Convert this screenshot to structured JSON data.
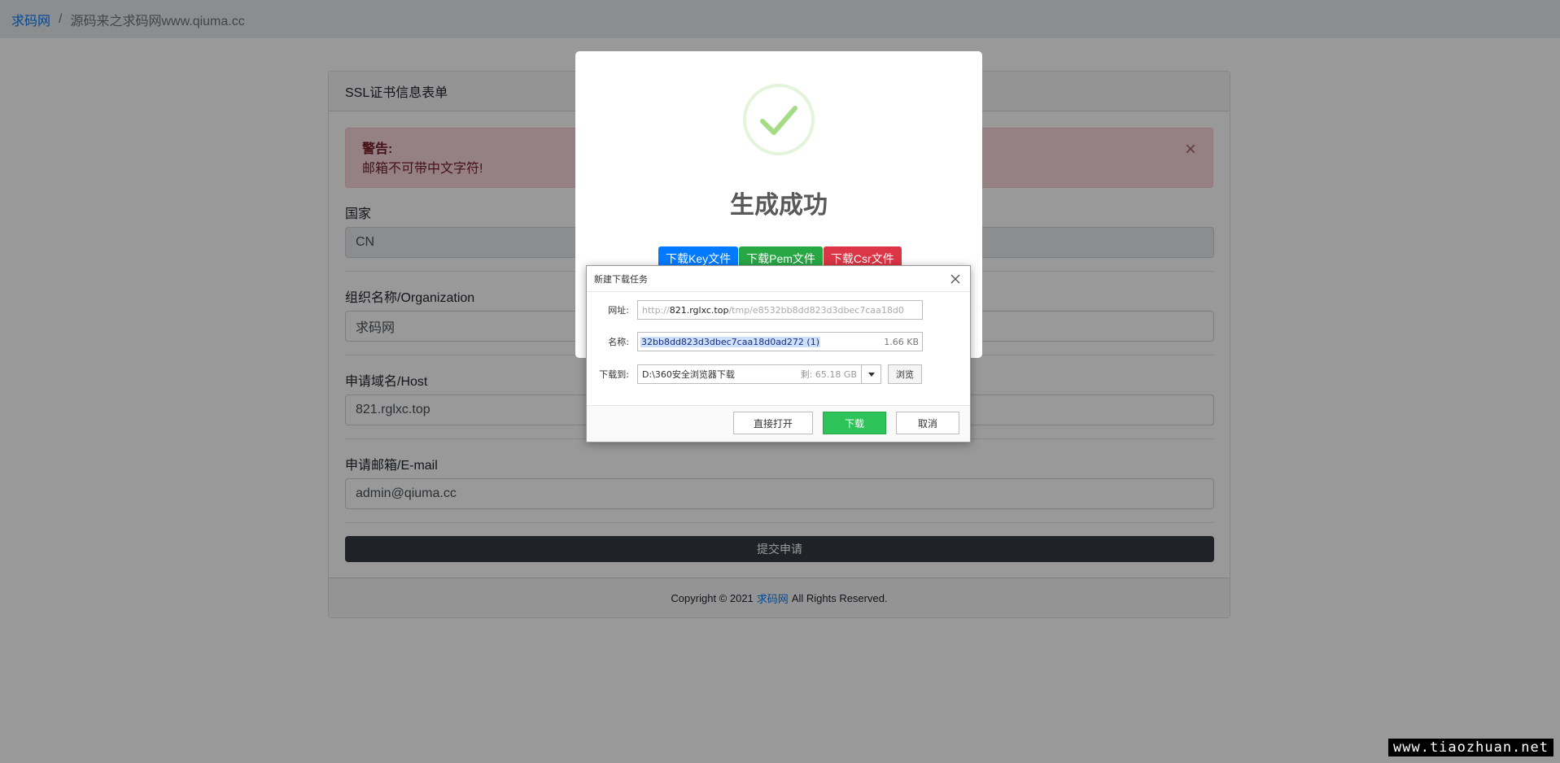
{
  "breadcrumb": {
    "home": "求码网",
    "current": "源码来之求码网www.qiuma.cc"
  },
  "card": {
    "title": "SSL证书信息表单",
    "alert": {
      "title": "警告:",
      "message": "邮箱不可带中文字符!",
      "close": "×"
    },
    "fields": [
      {
        "label": "国家",
        "value": "CN"
      },
      {
        "label": "组织名称/Organization",
        "value": "求码网"
      },
      {
        "label": "申请域名/Host",
        "value": "821.rglxc.top"
      },
      {
        "label": "申请邮箱/E-mail",
        "value": "admin@qiuma.cc"
      }
    ],
    "submit": "提交申请",
    "footer": {
      "prefix": "Copyright © 2021",
      "link": "求码网",
      "suffix": "All Rights Reserved."
    }
  },
  "modal": {
    "title": "生成成功",
    "buttons": {
      "key": "下载Key文件",
      "pem": "下载Pem文件",
      "csr": "下载Csr文件"
    },
    "icon": "success-check-icon",
    "colors": {
      "success": "#a5dc86",
      "key": "#007bff",
      "pem": "#28a745",
      "csr": "#dc3545"
    }
  },
  "download_dialog": {
    "title": "新建下载任务",
    "url_label": "网址:",
    "url_prefix": "http://",
    "url_host": "821.rglxc.top",
    "url_rest": "/tmp/e8532bb8dd823d3dbec7caa18d0",
    "name_label": "名称:",
    "name_value": "32bb8dd823d3dbec7caa18d0ad272 (1)",
    "size": "1.66 KB",
    "save_label": "下载到:",
    "save_path": "D:\\360安全浏览器下载",
    "free_space": "剩: 65.18 GB",
    "browse": "浏览",
    "open_direct": "直接打开",
    "download": "下载",
    "cancel": "取消"
  },
  "watermark": "www.tiaozhuan.net"
}
